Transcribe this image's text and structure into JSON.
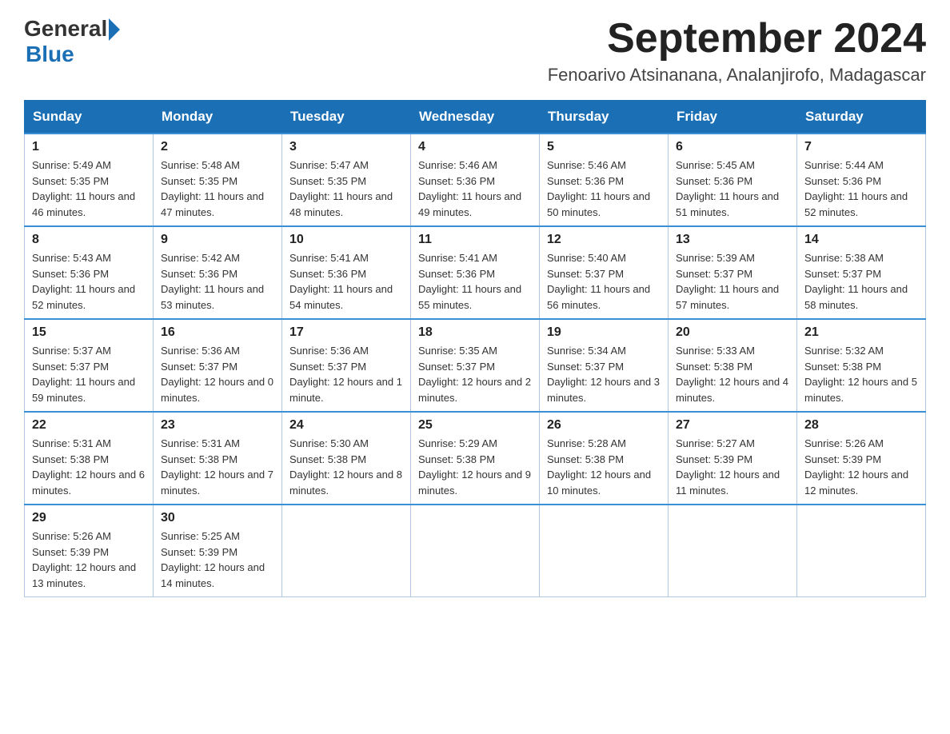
{
  "logo": {
    "general": "General",
    "blue": "Blue"
  },
  "title": "September 2024",
  "location": "Fenoarivo Atsinanana, Analanjirofo, Madagascar",
  "days_of_week": [
    "Sunday",
    "Monday",
    "Tuesday",
    "Wednesday",
    "Thursday",
    "Friday",
    "Saturday"
  ],
  "weeks": [
    [
      {
        "day": "1",
        "sunrise": "5:49 AM",
        "sunset": "5:35 PM",
        "daylight": "11 hours and 46 minutes."
      },
      {
        "day": "2",
        "sunrise": "5:48 AM",
        "sunset": "5:35 PM",
        "daylight": "11 hours and 47 minutes."
      },
      {
        "day": "3",
        "sunrise": "5:47 AM",
        "sunset": "5:35 PM",
        "daylight": "11 hours and 48 minutes."
      },
      {
        "day": "4",
        "sunrise": "5:46 AM",
        "sunset": "5:36 PM",
        "daylight": "11 hours and 49 minutes."
      },
      {
        "day": "5",
        "sunrise": "5:46 AM",
        "sunset": "5:36 PM",
        "daylight": "11 hours and 50 minutes."
      },
      {
        "day": "6",
        "sunrise": "5:45 AM",
        "sunset": "5:36 PM",
        "daylight": "11 hours and 51 minutes."
      },
      {
        "day": "7",
        "sunrise": "5:44 AM",
        "sunset": "5:36 PM",
        "daylight": "11 hours and 52 minutes."
      }
    ],
    [
      {
        "day": "8",
        "sunrise": "5:43 AM",
        "sunset": "5:36 PM",
        "daylight": "11 hours and 52 minutes."
      },
      {
        "day": "9",
        "sunrise": "5:42 AM",
        "sunset": "5:36 PM",
        "daylight": "11 hours and 53 minutes."
      },
      {
        "day": "10",
        "sunrise": "5:41 AM",
        "sunset": "5:36 PM",
        "daylight": "11 hours and 54 minutes."
      },
      {
        "day": "11",
        "sunrise": "5:41 AM",
        "sunset": "5:36 PM",
        "daylight": "11 hours and 55 minutes."
      },
      {
        "day": "12",
        "sunrise": "5:40 AM",
        "sunset": "5:37 PM",
        "daylight": "11 hours and 56 minutes."
      },
      {
        "day": "13",
        "sunrise": "5:39 AM",
        "sunset": "5:37 PM",
        "daylight": "11 hours and 57 minutes."
      },
      {
        "day": "14",
        "sunrise": "5:38 AM",
        "sunset": "5:37 PM",
        "daylight": "11 hours and 58 minutes."
      }
    ],
    [
      {
        "day": "15",
        "sunrise": "5:37 AM",
        "sunset": "5:37 PM",
        "daylight": "11 hours and 59 minutes."
      },
      {
        "day": "16",
        "sunrise": "5:36 AM",
        "sunset": "5:37 PM",
        "daylight": "12 hours and 0 minutes."
      },
      {
        "day": "17",
        "sunrise": "5:36 AM",
        "sunset": "5:37 PM",
        "daylight": "12 hours and 1 minute."
      },
      {
        "day": "18",
        "sunrise": "5:35 AM",
        "sunset": "5:37 PM",
        "daylight": "12 hours and 2 minutes."
      },
      {
        "day": "19",
        "sunrise": "5:34 AM",
        "sunset": "5:37 PM",
        "daylight": "12 hours and 3 minutes."
      },
      {
        "day": "20",
        "sunrise": "5:33 AM",
        "sunset": "5:38 PM",
        "daylight": "12 hours and 4 minutes."
      },
      {
        "day": "21",
        "sunrise": "5:32 AM",
        "sunset": "5:38 PM",
        "daylight": "12 hours and 5 minutes."
      }
    ],
    [
      {
        "day": "22",
        "sunrise": "5:31 AM",
        "sunset": "5:38 PM",
        "daylight": "12 hours and 6 minutes."
      },
      {
        "day": "23",
        "sunrise": "5:31 AM",
        "sunset": "5:38 PM",
        "daylight": "12 hours and 7 minutes."
      },
      {
        "day": "24",
        "sunrise": "5:30 AM",
        "sunset": "5:38 PM",
        "daylight": "12 hours and 8 minutes."
      },
      {
        "day": "25",
        "sunrise": "5:29 AM",
        "sunset": "5:38 PM",
        "daylight": "12 hours and 9 minutes."
      },
      {
        "day": "26",
        "sunrise": "5:28 AM",
        "sunset": "5:38 PM",
        "daylight": "12 hours and 10 minutes."
      },
      {
        "day": "27",
        "sunrise": "5:27 AM",
        "sunset": "5:39 PM",
        "daylight": "12 hours and 11 minutes."
      },
      {
        "day": "28",
        "sunrise": "5:26 AM",
        "sunset": "5:39 PM",
        "daylight": "12 hours and 12 minutes."
      }
    ],
    [
      {
        "day": "29",
        "sunrise": "5:26 AM",
        "sunset": "5:39 PM",
        "daylight": "12 hours and 13 minutes."
      },
      {
        "day": "30",
        "sunrise": "5:25 AM",
        "sunset": "5:39 PM",
        "daylight": "12 hours and 14 minutes."
      },
      null,
      null,
      null,
      null,
      null
    ]
  ],
  "labels": {
    "sunrise": "Sunrise:",
    "sunset": "Sunset:",
    "daylight": "Daylight:"
  }
}
